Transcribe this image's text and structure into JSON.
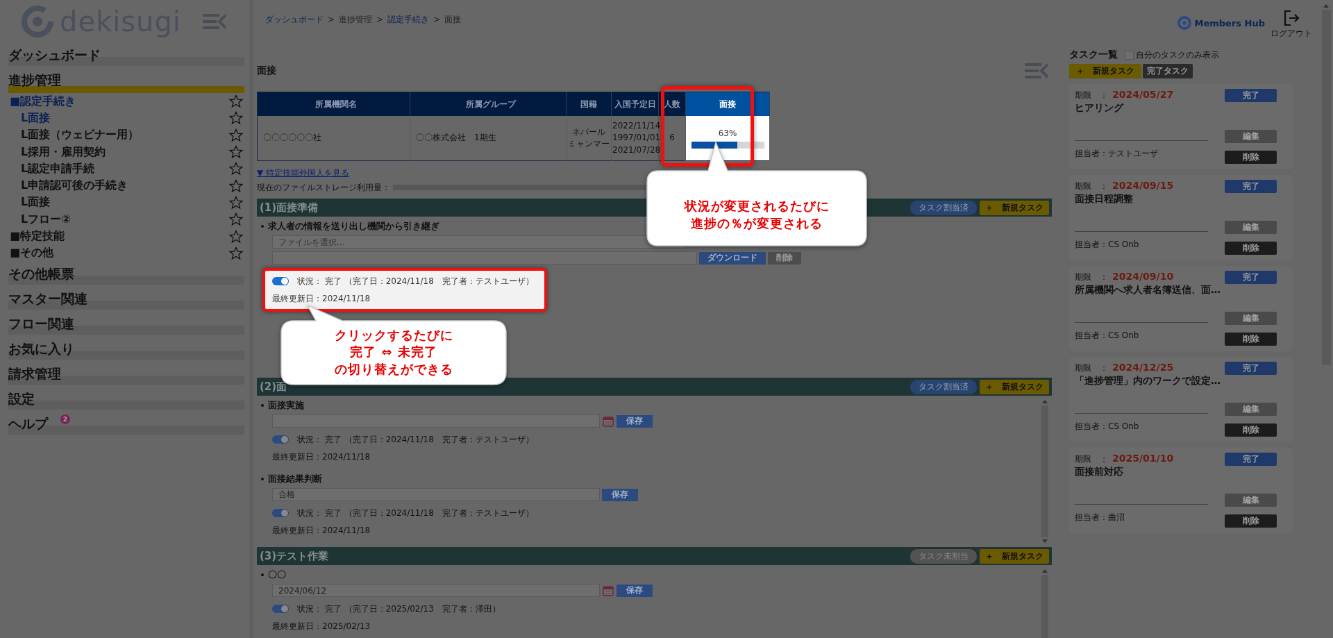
{
  "sidebar": {
    "logo": "dekisugi",
    "items": [
      {
        "label": "ダッシュボード",
        "selected": false
      },
      {
        "label": "進捗管理",
        "selected": true,
        "children": [
          {
            "label": "■認定手続き",
            "selected": true,
            "children": [
              {
                "label": "L面接",
                "selected": true
              },
              {
                "label": "L面接（ウェビナー用）",
                "selected": false
              },
              {
                "label": "L採用・雇用契約",
                "selected": false
              },
              {
                "label": "L認定申請手続",
                "selected": false
              },
              {
                "label": "L申請認可後の手続き",
                "selected": false
              },
              {
                "label": "L面接",
                "selected": false
              },
              {
                "label": "Lフロー②",
                "selected": false
              }
            ]
          },
          {
            "label": "■特定技能",
            "selected": false
          },
          {
            "label": "■その他",
            "selected": false
          }
        ]
      },
      {
        "label": "その他帳票",
        "selected": false
      },
      {
        "label": "マスター関連",
        "selected": false
      },
      {
        "label": "フロー関連",
        "selected": false
      },
      {
        "label": "お気に入り",
        "selected": false
      },
      {
        "label": "請求管理",
        "selected": false
      },
      {
        "label": "設定",
        "selected": false
      },
      {
        "label": "ヘルプ",
        "selected": false,
        "badge": "2"
      }
    ]
  },
  "breadcrumb": {
    "separator": ">",
    "items": [
      {
        "label": "ダッシュボード",
        "link": true
      },
      {
        "label": "進捗管理",
        "link": false
      },
      {
        "label": "認定手続き",
        "link": true
      },
      {
        "label": "面接",
        "link": false
      }
    ]
  },
  "page_title": "面接",
  "table": {
    "columns": [
      "所属機関名",
      "所属グループ",
      "国籍",
      "入国予定日",
      "人数",
      "面接"
    ],
    "rows": [
      {
        "cells": [
          [
            "〇〇〇〇〇〇社"
          ],
          [
            "〇〇株式会社　1期生"
          ],
          [
            "ネパール",
            "ミャンマー"
          ],
          [
            "2022/11/14",
            "1997/01/01",
            "2021/07/28"
          ],
          [
            "6"
          ]
        ],
        "progress": {
          "reading": "63%",
          "level": 0.63
        }
      }
    ]
  },
  "foreigners_link": "▼ 特定技能外国人を見る",
  "storage_label": "現在のファイルストレージ利用量：",
  "sections": [
    {
      "title": "(1)面接準備",
      "assign": {
        "label": "タスク割当済",
        "assigned": true
      },
      "new_task": "＋　新規タスク",
      "items": [
        {
          "kind": "file",
          "title": "求人者の情報を送り出し機関から引き継ぎ",
          "placeholder": "ファイルを選択...",
          "buttons": [
            "ダウンロード",
            "削除"
          ],
          "status": {
            "on": true,
            "text": "状況： 完了 （完了日：2024/11/18　完了者：テストユーザ）"
          },
          "updated": "最終更新日：2024/11/18",
          "highlighted": true
        }
      ]
    },
    {
      "title": "(2)面",
      "assign": {
        "label": "タスク割当済",
        "assigned": true
      },
      "new_task": "＋　新規タスク",
      "items": [
        {
          "kind": "date",
          "title": "面接実施",
          "save": "保存",
          "status": {
            "on": true,
            "text": "状況： 完了 （完了日：2024/11/18　完了者：テストユーザ）"
          },
          "updated": "最終更新日：2024/11/18",
          "highlighted": false
        },
        {
          "kind": "text",
          "title": "面接結果判断",
          "value": "合格",
          "save": "保存",
          "status": {
            "on": true,
            "text": "状況： 完了 （完了日：2024/11/18　完了者：テストユーザ）"
          },
          "updated": "最終更新日：2024/11/18",
          "highlighted": false
        }
      ]
    },
    {
      "title": "(3)テスト作業",
      "assign": {
        "label": "タスク未割当",
        "assigned": false
      },
      "new_task": "＋　新規タスク",
      "items": [
        {
          "kind": "date",
          "title": "〇〇",
          "value": "2024/06/12",
          "save": "保存",
          "status": {
            "on": true,
            "text": "状況： 完了 （完了日：2025/02/13　完了者：澤田）"
          },
          "updated": "最終更新日：2025/02/13",
          "highlighted": false
        }
      ]
    }
  ],
  "callouts": [
    [
      "状況が変更されるたびに",
      "進捗の％が変更される"
    ],
    [
      "クリックするたびに",
      "完了 ⇔ 未完了",
      "の切り替えができる"
    ]
  ],
  "header": {
    "brand": "Members Hub",
    "logout": "ログアウト"
  },
  "tasks": {
    "title": "タスク一覧",
    "only_mine": {
      "label": "自分のタスクのみ表示",
      "checked": false
    },
    "new_button": "＋　新規タスク",
    "done_button": "完了タスク",
    "cards": [
      {
        "due_label": "期限　：",
        "due": "2024/05/27",
        "title": "ヒアリング",
        "assignee": "担当者：テストユーザ",
        "buttons": [
          "完了",
          "編集",
          "削除"
        ]
      },
      {
        "due_label": "期限　：",
        "due": "2024/09/15",
        "title": "面接日程調整",
        "assignee": "担当者：CS Onb",
        "buttons": [
          "完了",
          "編集",
          "削除"
        ]
      },
      {
        "due_label": "期限　：",
        "due": "2024/09/10",
        "title": "所属機関へ求人者名簿送信、面…",
        "assignee": "担当者：CS Onb",
        "buttons": [
          "完了",
          "編集",
          "削除"
        ]
      },
      {
        "due_label": "期限　：",
        "due": "2024/12/25",
        "title": "「進捗管理」内のワークで設定…",
        "assignee": "担当者：CS Onb",
        "buttons": [
          "完了",
          "編集",
          "削除"
        ]
      },
      {
        "due_label": "期限　：",
        "due": "2025/01/10",
        "title": "面接前対応",
        "assignee": "担当者：曲沼",
        "buttons": [
          "完了",
          "編集",
          "削除"
        ]
      }
    ]
  }
}
